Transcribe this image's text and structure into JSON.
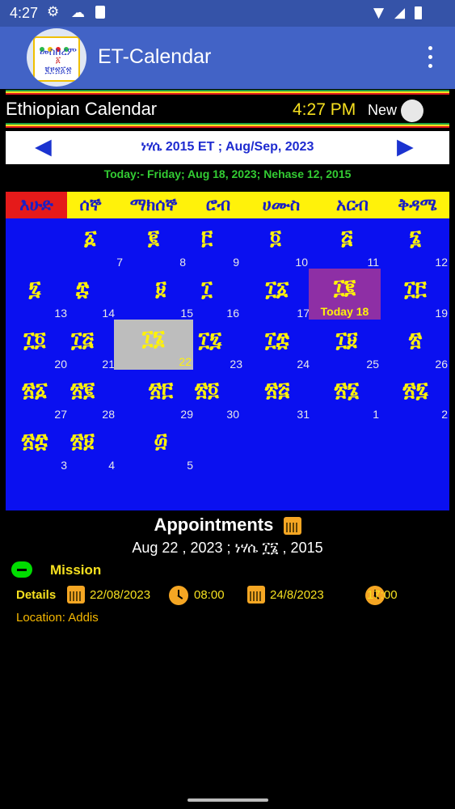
{
  "status_bar": {
    "time": "4:27",
    "icons": [
      "gear-icon",
      "cloud-icon",
      "sd-card-icon",
      "wifi-icon",
      "signal-icon",
      "battery-icon"
    ]
  },
  "app_bar": {
    "title": "ET-Calendar",
    "logo_text": [
      "መስከረም",
      "፩",
      "፪፻፳፩፳"
    ]
  },
  "header": {
    "title": "Ethiopian Calendar",
    "time": "4:27 PM",
    "new_label": "New"
  },
  "month_nav": {
    "prev_icon": "◀",
    "next_icon": "▶",
    "label": "ነሃሴ  2015 ET  ;  Aug/Sep, 2023"
  },
  "today_text": "Today:-  Friday; Aug 18, 2023; Nehase 12, 2015",
  "weekdays": [
    "እሁድ",
    "ሰኞ",
    "ማክሰኞ",
    "ሮብ",
    "ሀሙስ",
    "አርብ",
    "ቅዳሜ"
  ],
  "calendar": {
    "today_label": "Today 18",
    "days": [
      {
        "geez": "፩",
        "greg": "7"
      },
      {
        "geez": "፪",
        "greg": "8"
      },
      {
        "geez": "፫",
        "greg": "9"
      },
      {
        "geez": "፬",
        "greg": "10"
      },
      {
        "geez": "፭",
        "greg": "11"
      },
      {
        "geez": "፮",
        "greg": "12"
      },
      {
        "geez": "፯",
        "greg": "13"
      },
      {
        "geez": "፰",
        "greg": "14"
      },
      {
        "geez": "፱",
        "greg": "15"
      },
      {
        "geez": "፲",
        "greg": "16"
      },
      {
        "geez": "፲፩",
        "greg": "17"
      },
      {
        "geez": "፲፪",
        "greg": "Today 18"
      },
      {
        "geez": "፲፫",
        "greg": "19"
      },
      {
        "geez": "፲፬",
        "greg": "20"
      },
      {
        "geez": "፲፭",
        "greg": "21"
      },
      {
        "geez": "፲፮",
        "greg": "22"
      },
      {
        "geez": "፲፯",
        "greg": "23"
      },
      {
        "geez": "፲፰",
        "greg": "24"
      },
      {
        "geez": "፲፱",
        "greg": "25"
      },
      {
        "geez": "፳",
        "greg": "26"
      },
      {
        "geez": "፳፩",
        "greg": "27"
      },
      {
        "geez": "፳፪",
        "greg": "28"
      },
      {
        "geez": "፳፫",
        "greg": "29"
      },
      {
        "geez": "፳፬",
        "greg": "30"
      },
      {
        "geez": "፳፭",
        "greg": "31"
      },
      {
        "geez": "፳፮",
        "greg": "1"
      },
      {
        "geez": "፳፯",
        "greg": "2"
      },
      {
        "geez": "፳፰",
        "greg": "3"
      },
      {
        "geez": "፳፱",
        "greg": "4"
      },
      {
        "geez": "፴",
        "greg": "5"
      }
    ]
  },
  "appointments": {
    "title": "Appointments",
    "date": "Aug 22 , 2023 ; ነሃሴ ፲፮ , 2015",
    "items": [
      {
        "name": "Mission",
        "details_label": "Details",
        "start_date": "22/08/2023",
        "start_time": "08:00",
        "end_date": "24/8/2023",
        "end_time": "17:00",
        "location": "Location: Addis"
      }
    ]
  },
  "colors": {
    "app_bar": "#4263c6",
    "calendar_bg": "#0a10f0",
    "weekday_bg": "#fff20a",
    "today_bg": "#8e2fa5",
    "selected_bg": "#bdbdbd",
    "accent_yellow": "#f6e01f"
  }
}
